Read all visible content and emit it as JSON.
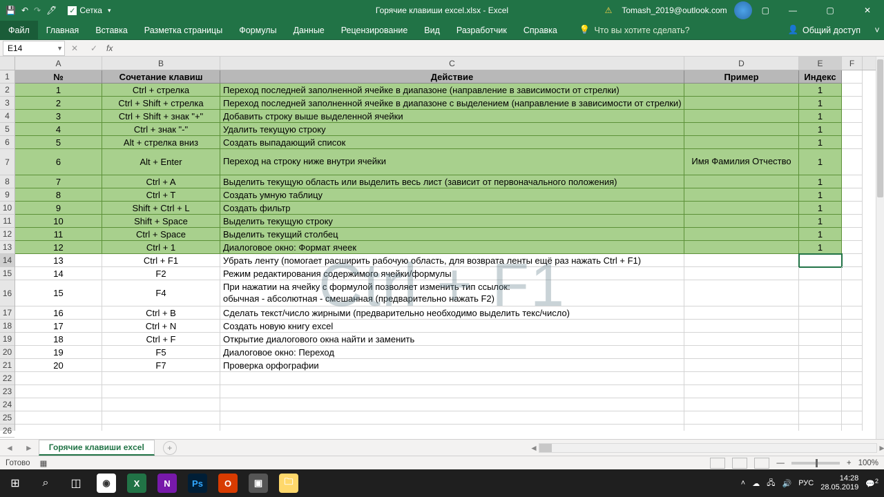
{
  "title": "Горячие клавиши excel.xlsx  -  Excel",
  "user": "Tomash_2019@outlook.com",
  "qat": {
    "grid_label": "Сетка"
  },
  "tabs": [
    "Файл",
    "Главная",
    "Вставка",
    "Разметка страницы",
    "Формулы",
    "Данные",
    "Рецензирование",
    "Вид",
    "Разработчик",
    "Справка"
  ],
  "tell_me": "Что вы хотите сделать?",
  "share_label": "Общий доступ",
  "name_box": "E14",
  "columns": [
    "A",
    "B",
    "C",
    "D",
    "E",
    "F"
  ],
  "headers": {
    "A": "№",
    "B": "Сочетание клавиш",
    "C": "Действие",
    "D": "Пример",
    "E": "Индекс"
  },
  "rows": [
    {
      "n": "1",
      "k": "Ctrl + стрелка",
      "a": "Переход последней заполненной ячейке в диапазоне (направление в зависимости от стрелки)",
      "i": "1",
      "g": true
    },
    {
      "n": "2",
      "k": "Ctrl + Shift + стрелка",
      "a": "Переход последней заполненной ячейке в диапазоне с выделением (направление в зависимости от стрелки)",
      "i": "1",
      "g": true
    },
    {
      "n": "3",
      "k": "Ctrl + Shift + знак \"+\"",
      "a": "Добавить строку выше выделенной ячейки",
      "i": "1",
      "g": true
    },
    {
      "n": "4",
      "k": "Ctrl + знак \"-\"",
      "a": "Удалить текущую строку",
      "i": "1",
      "g": true
    },
    {
      "n": "5",
      "k": "Alt + стрелка вниз",
      "a": "Создать выпадающий список",
      "i": "1",
      "g": true
    },
    {
      "n": "6",
      "k": "Alt + Enter",
      "a": "Переход на строку ниже внутри ячейки",
      "d": "Имя Фамилия Отчество",
      "i": "1",
      "g": true,
      "tall": true
    },
    {
      "n": "7",
      "k": "Ctrl + A",
      "a": "Выделить текущую область или выделить весь лист (зависит от первоначального положения)",
      "i": "1",
      "g": true
    },
    {
      "n": "8",
      "k": "Ctrl + T",
      "a": "Создать умную таблицу",
      "i": "1",
      "g": true
    },
    {
      "n": "9",
      "k": "Shift + Ctrl + L",
      "a": "Создать фильтр",
      "i": "1",
      "g": true
    },
    {
      "n": "10",
      "k": "Shift + Space",
      "a": "Выделить текущую строку",
      "i": "1",
      "g": true
    },
    {
      "n": "11",
      "k": "Ctrl + Space",
      "a": "Выделить текущий столбец",
      "i": "1",
      "g": true
    },
    {
      "n": "12",
      "k": "Ctrl + 1",
      "a": "Диалоговое окно: Формат ячеек",
      "i": "1",
      "g": true
    },
    {
      "n": "13",
      "k": "Ctrl + F1",
      "a": "Убрать ленту (помогает расширить рабочую область, для возврата ленты ещё раз нажать Ctrl + F1)",
      "i": "",
      "sel": true
    },
    {
      "n": "14",
      "k": "F2",
      "a": "Режим редактирования содержимого ячейки/формулы"
    },
    {
      "n": "15",
      "k": "F4",
      "a": "При нажатии на ячейку с формулой позволяет изменить тип ссылок:\nобычная - абсолютная - смешанная (предварительно нажать F2)",
      "tall": true
    },
    {
      "n": "16",
      "k": "Ctrl + B",
      "a": "Сделать текст/число жирными (предварительно необходимо выделить текс/число)"
    },
    {
      "n": "17",
      "k": "Ctrl + N",
      "a": "Создать новую книгу excel"
    },
    {
      "n": "18",
      "k": "Ctrl + F",
      "a": "Открытие диалогового окна найти и заменить"
    },
    {
      "n": "19",
      "k": "F5",
      "a": "Диалоговое окно: Переход"
    },
    {
      "n": "20",
      "k": "F7",
      "a": "Проверка орфографии"
    }
  ],
  "watermark": "Ctrl + F1",
  "sheet_tab": "Горячие клавиши excel",
  "status": "Готово",
  "zoom": "100%",
  "tray": {
    "lang": "РУС",
    "time": "14:28",
    "date": "28.05.2019",
    "notif": "2"
  },
  "col_widths": {
    "A": 126,
    "B": 171,
    "C": 672,
    "D": 166,
    "E": 62,
    "F": 30
  }
}
